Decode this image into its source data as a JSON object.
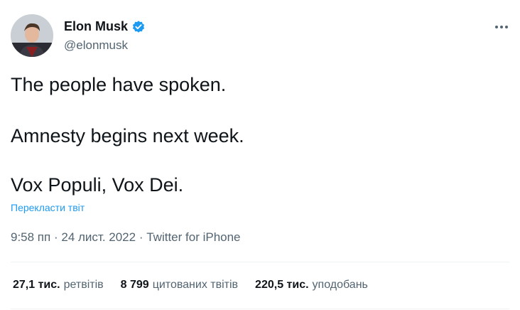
{
  "author": {
    "name": "Elon Musk",
    "handle": "@elonmusk"
  },
  "tweet": {
    "lines": [
      "The people have spoken.",
      "Amnesty begins next week.",
      "Vox Populi, Vox Dei."
    ],
    "translate_label": "Перекласти твіт"
  },
  "meta": {
    "time": "9:58 пп",
    "date": "24 лист. 2022",
    "source": "Twitter for iPhone",
    "separator": "·"
  },
  "stats": [
    {
      "count": "27,1 тис.",
      "label": "ретвітів"
    },
    {
      "count": "8 799",
      "label": "цитованих твітів"
    },
    {
      "count": "220,5 тис.",
      "label": "уподобань"
    }
  ],
  "colors": {
    "accent": "#1d9bf0",
    "text": "#0f1419",
    "secondary": "#536471"
  },
  "icons": {
    "verified": "verified-badge-icon",
    "more": "more-icon"
  }
}
